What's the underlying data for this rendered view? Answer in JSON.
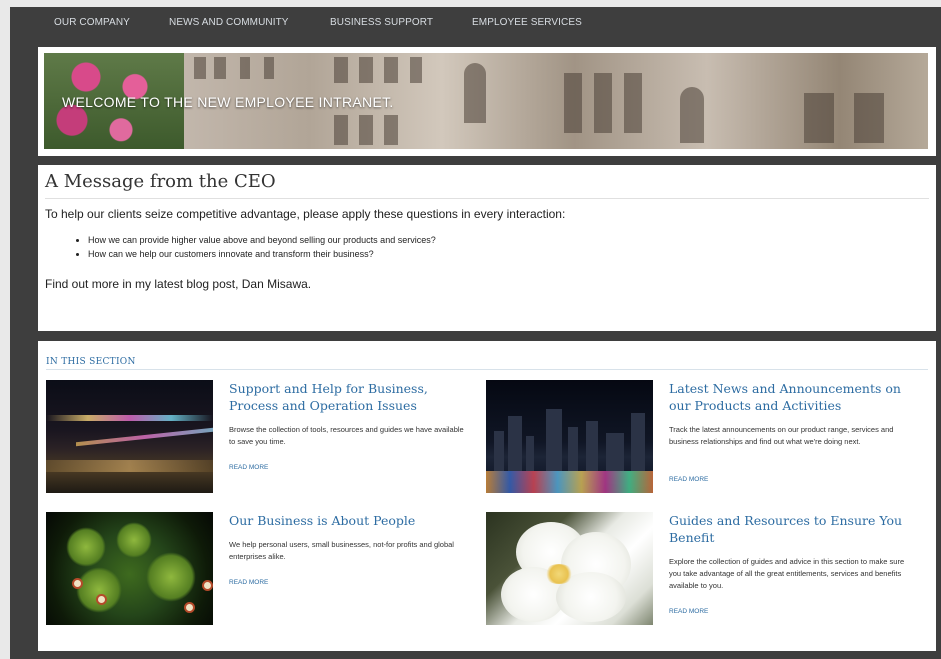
{
  "nav": {
    "items": [
      {
        "label": "OUR COMPANY"
      },
      {
        "label": "NEWS AND COMMUNITY"
      },
      {
        "label": "BUSINESS SUPPORT"
      },
      {
        "label": "EMPLOYEE SERVICES"
      }
    ]
  },
  "banner": {
    "text": "WELCOME TO THE NEW EMPLOYEE INTRANET."
  },
  "ceo": {
    "title": "A Message from the CEO",
    "intro": "To help our clients seize competitive advantage, please apply these questions in every interaction:",
    "bullets": [
      "How we can provide higher value above and beyond selling our products and services?",
      "How can we help our customers innovate and transform their business?"
    ],
    "outro": "Find out more in my latest blog post, Dan Misawa."
  },
  "section": {
    "title": "IN THIS SECTION",
    "cards": [
      {
        "title": "Support and Help for Business, Process and Operation Issues",
        "description": "Browse the collection of tools, resources and guides we have available to save you time.",
        "more": "READ MORE"
      },
      {
        "title": "Latest News and Announcements on our Products and Activities",
        "description": "Track the latest announcements on our product range, services and business relationships and find out what we're doing next.",
        "more": "READ MORE"
      },
      {
        "title": "Our Business is About People",
        "description": "We help personal users, small businesses, not-for profits and global enterprises alike.",
        "more": "READ MORE"
      },
      {
        "title": "Guides and Resources to Ensure You Benefit",
        "description": "Explore the collection of guides and advice in this section to make sure you take advantage of all the great entitlements, services and benefits available to you.",
        "more": "READ MORE"
      }
    ]
  },
  "colors": {
    "link": "#2d6ca2",
    "frame": "#3e3e3e",
    "nav_text": "#d8dde2"
  }
}
